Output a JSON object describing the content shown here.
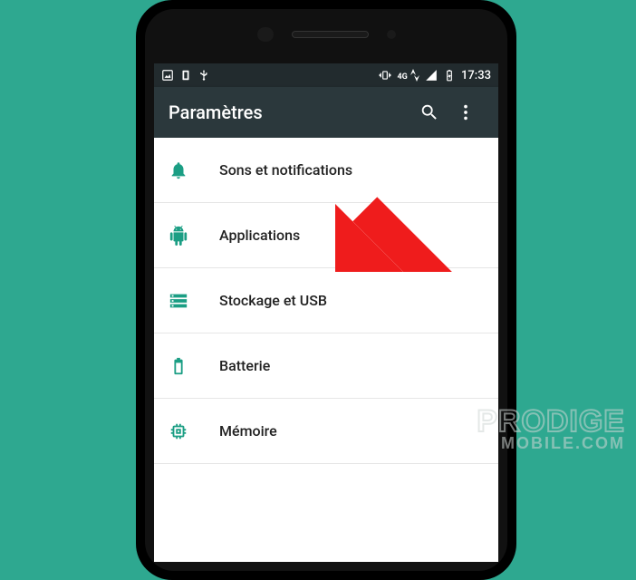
{
  "status_bar": {
    "time": "17:33",
    "network_label": "4G"
  },
  "app_bar": {
    "title": "Paramètres"
  },
  "settings_list": [
    {
      "icon": "bell-icon",
      "label": "Sons et notifications"
    },
    {
      "icon": "android-icon",
      "label": "Applications"
    },
    {
      "icon": "storage-icon",
      "label": "Stockage et USB"
    },
    {
      "icon": "battery-icon",
      "label": "Batterie"
    },
    {
      "icon": "memory-icon",
      "label": "Mémoire"
    }
  ],
  "watermark": {
    "top": "PRODIGE",
    "bottom": "MOBILE.COM"
  },
  "colors": {
    "background": "#2ea890",
    "accent": "#1b9e84",
    "appbar": "#2b383c",
    "arrow": "#ef1c1c"
  }
}
